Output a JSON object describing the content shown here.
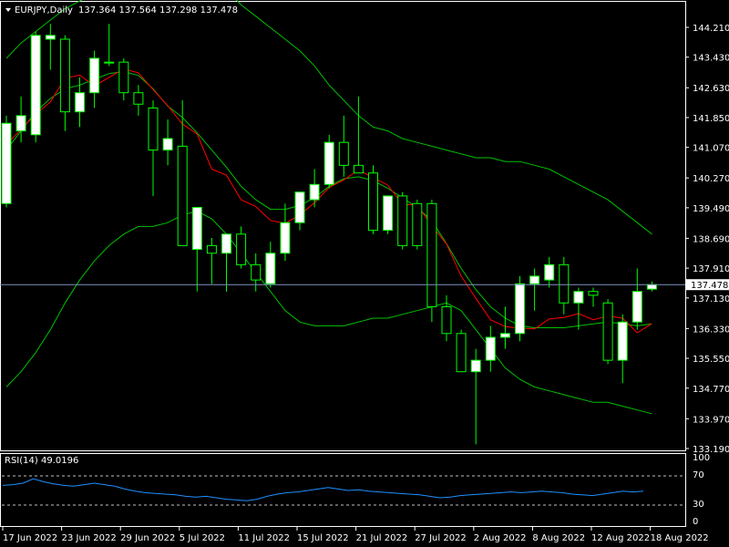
{
  "chart_data": {
    "type": "candlestick",
    "symbol_label": "EURJPY,Daily",
    "ohlc_header": "137.364 137.564 137.298 137.478",
    "current_price_label": "137.478",
    "colors": {
      "background": "#000000",
      "frame": "#ffffff",
      "bull_body": "#ffffff",
      "bear_body": "#000000",
      "wick": "#00ff00",
      "moving_average": "#ff0000",
      "bollinger_band": "#00c000",
      "price_line": "#8090c0",
      "rsi_line": "#1e90ff",
      "rsi_levels": "#c0c0c0"
    },
    "price_axis": {
      "min": 133.19,
      "max": 144.8,
      "tick_labels": [
        "144.210",
        "143.430",
        "142.630",
        "141.850",
        "141.070",
        "140.270",
        "139.490",
        "138.690",
        "137.910",
        "137.130",
        "136.330",
        "135.550",
        "134.770",
        "133.970",
        "133.190"
      ]
    },
    "date_labels": [
      "17 Jun 2022",
      "23 Jun 2022",
      "29 Jun 2022",
      "5 Jul 2022",
      "11 Jul 2022",
      "15 Jul 2022",
      "21 Jul 2022",
      "27 Jul 2022",
      "2 Aug 2022",
      "8 Aug 2022",
      "12 Aug 2022",
      "18 Aug 2022"
    ],
    "candles": [
      {
        "o": 139.6,
        "h": 141.9,
        "l": 139.5,
        "c": 141.7
      },
      {
        "o": 141.5,
        "h": 142.4,
        "l": 141.2,
        "c": 141.9
      },
      {
        "o": 141.4,
        "h": 144.1,
        "l": 141.2,
        "c": 144.0
      },
      {
        "o": 143.9,
        "h": 144.3,
        "l": 143.1,
        "c": 144.0
      },
      {
        "o": 143.9,
        "h": 144.0,
        "l": 141.5,
        "c": 142.0
      },
      {
        "o": 142.0,
        "h": 142.9,
        "l": 141.6,
        "c": 142.5
      },
      {
        "o": 142.5,
        "h": 143.6,
        "l": 142.1,
        "c": 143.4
      },
      {
        "o": 143.3,
        "h": 144.3,
        "l": 143.2,
        "c": 143.3
      },
      {
        "o": 143.3,
        "h": 143.4,
        "l": 142.3,
        "c": 142.5
      },
      {
        "o": 142.5,
        "h": 142.7,
        "l": 141.9,
        "c": 142.2
      },
      {
        "o": 142.1,
        "h": 142.3,
        "l": 139.8,
        "c": 141.0
      },
      {
        "o": 141.0,
        "h": 141.8,
        "l": 140.6,
        "c": 141.3
      },
      {
        "o": 141.1,
        "h": 142.3,
        "l": 139.7,
        "c": 138.5
      },
      {
        "o": 138.4,
        "h": 139.5,
        "l": 137.3,
        "c": 139.5
      },
      {
        "o": 138.5,
        "h": 138.7,
        "l": 137.5,
        "c": 138.3
      },
      {
        "o": 138.3,
        "h": 138.8,
        "l": 137.3,
        "c": 138.8
      },
      {
        "o": 138.8,
        "h": 139.0,
        "l": 137.9,
        "c": 138.0
      },
      {
        "o": 138.0,
        "h": 138.3,
        "l": 137.3,
        "c": 137.6
      },
      {
        "o": 137.5,
        "h": 138.6,
        "l": 137.4,
        "c": 138.3
      },
      {
        "o": 138.3,
        "h": 139.6,
        "l": 138.1,
        "c": 139.1
      },
      {
        "o": 139.1,
        "h": 139.9,
        "l": 138.9,
        "c": 139.9
      },
      {
        "o": 139.7,
        "h": 140.5,
        "l": 139.5,
        "c": 140.1
      },
      {
        "o": 140.1,
        "h": 141.4,
        "l": 140.0,
        "c": 141.2
      },
      {
        "o": 141.2,
        "h": 141.9,
        "l": 140.3,
        "c": 140.6
      },
      {
        "o": 140.6,
        "h": 142.4,
        "l": 140.4,
        "c": 140.4
      },
      {
        "o": 140.4,
        "h": 140.6,
        "l": 138.8,
        "c": 138.9
      },
      {
        "o": 138.9,
        "h": 139.8,
        "l": 138.8,
        "c": 139.8
      },
      {
        "o": 139.8,
        "h": 139.9,
        "l": 138.4,
        "c": 138.5
      },
      {
        "o": 139.6,
        "h": 139.7,
        "l": 138.4,
        "c": 138.5
      },
      {
        "o": 139.6,
        "h": 139.7,
        "l": 136.5,
        "c": 136.9
      },
      {
        "o": 136.9,
        "h": 137.2,
        "l": 136.0,
        "c": 136.2
      },
      {
        "o": 136.2,
        "h": 136.3,
        "l": 135.2,
        "c": 135.2
      },
      {
        "o": 135.2,
        "h": 135.8,
        "l": 133.3,
        "c": 135.5
      },
      {
        "o": 135.5,
        "h": 136.4,
        "l": 135.2,
        "c": 136.1
      },
      {
        "o": 136.1,
        "h": 136.9,
        "l": 135.8,
        "c": 136.2
      },
      {
        "o": 136.2,
        "h": 137.7,
        "l": 136.0,
        "c": 137.5
      },
      {
        "o": 137.5,
        "h": 137.9,
        "l": 136.8,
        "c": 137.7
      },
      {
        "o": 137.6,
        "h": 138.2,
        "l": 137.4,
        "c": 138.0
      },
      {
        "o": 138.0,
        "h": 138.2,
        "l": 136.7,
        "c": 137.0
      },
      {
        "o": 137.0,
        "h": 137.4,
        "l": 136.3,
        "c": 137.3
      },
      {
        "o": 137.3,
        "h": 137.4,
        "l": 136.9,
        "c": 137.2
      },
      {
        "o": 137.0,
        "h": 137.1,
        "l": 135.4,
        "c": 135.5
      },
      {
        "o": 135.5,
        "h": 136.7,
        "l": 134.9,
        "c": 136.5
      },
      {
        "o": 136.5,
        "h": 137.9,
        "l": 136.3,
        "c": 137.3
      },
      {
        "o": 137.36,
        "h": 137.56,
        "l": 137.3,
        "c": 137.48
      }
    ],
    "moving_average": [
      141.0,
      141.5,
      142.0,
      142.35,
      142.6,
      142.7,
      142.85,
      143.0,
      143.05,
      142.95,
      142.6,
      142.15,
      141.85,
      141.45,
      141.0,
      140.55,
      140.05,
      139.7,
      139.45,
      139.45,
      139.55,
      139.75,
      140.05,
      140.25,
      140.3,
      140.2,
      140.0,
      139.75,
      139.5,
      139.15,
      138.55,
      137.9,
      137.35,
      136.9,
      136.6,
      136.4,
      136.35,
      136.35,
      136.35,
      136.4,
      136.45,
      136.5,
      136.45,
      136.4,
      136.45
    ],
    "bollinger_upper": [
      143.4,
      143.8,
      144.1,
      144.4,
      144.7,
      144.9,
      145.1,
      145.3,
      145.5,
      145.7,
      145.7,
      145.8,
      145.9,
      145.7,
      145.5,
      145.2,
      144.8,
      144.5,
      144.2,
      143.9,
      143.6,
      143.2,
      142.7,
      142.3,
      141.9,
      141.6,
      141.5,
      141.3,
      141.2,
      141.1,
      141.0,
      140.9,
      140.8,
      140.8,
      140.7,
      140.7,
      140.6,
      140.5,
      140.3,
      140.1,
      139.9,
      139.7,
      139.4,
      139.1,
      138.8
    ],
    "bollinger_lower": [
      134.8,
      135.2,
      135.7,
      136.3,
      137.0,
      137.6,
      138.1,
      138.5,
      138.8,
      139.0,
      139.0,
      139.1,
      139.3,
      139.4,
      139.2,
      138.8,
      138.3,
      137.8,
      137.3,
      136.8,
      136.5,
      136.4,
      136.4,
      136.4,
      136.5,
      136.6,
      136.6,
      136.7,
      136.8,
      136.9,
      137.0,
      136.8,
      136.3,
      135.8,
      135.3,
      135.0,
      134.8,
      134.7,
      134.6,
      134.5,
      134.4,
      134.4,
      134.3,
      134.2,
      134.1
    ],
    "rsi": {
      "label": "RSI(14) 49.0196",
      "levels": [
        70,
        30
      ],
      "tick_labels": [
        "100",
        "70",
        "30",
        "0"
      ],
      "values": [
        57,
        58,
        60,
        66,
        62,
        59,
        57,
        56,
        58,
        60,
        58,
        56,
        52,
        49,
        47,
        46,
        45,
        44,
        42,
        41,
        42,
        40,
        38,
        37,
        36,
        38,
        42,
        45,
        47,
        48,
        50,
        52,
        54,
        52,
        50,
        51,
        49,
        48,
        47,
        46,
        45,
        44,
        42,
        40,
        41,
        43,
        44,
        45,
        46,
        47,
        48,
        47,
        48,
        49,
        48,
        47,
        45,
        44,
        43,
        45,
        47,
        49,
        48,
        49
      ]
    }
  }
}
